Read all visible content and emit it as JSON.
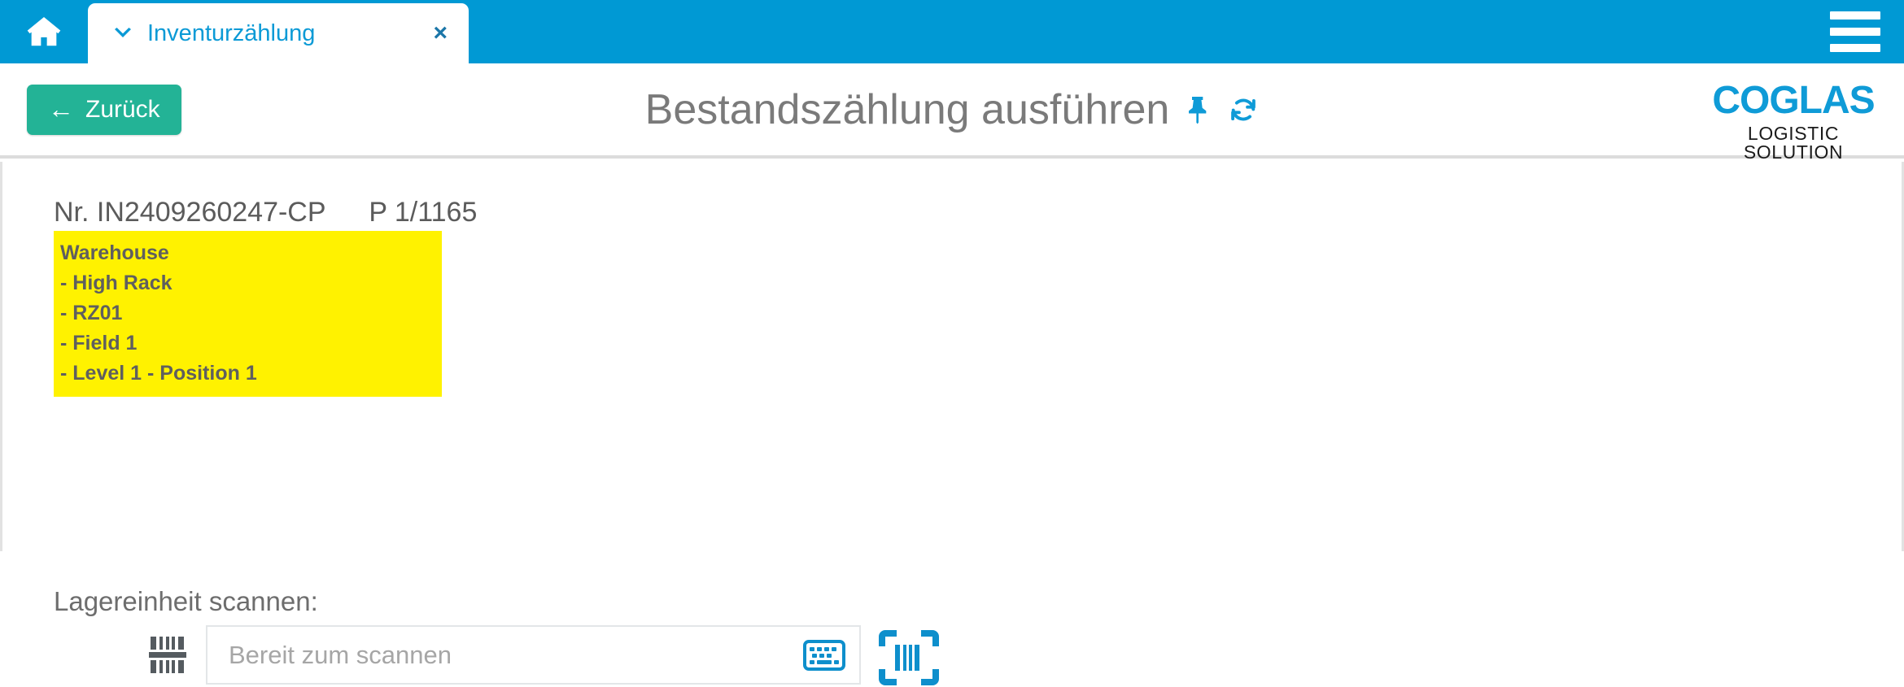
{
  "topbar": {
    "home_icon": "home-icon",
    "menu_icon": "hamburger-menu-icon",
    "tab": {
      "caret_icon": "chevron-down-icon",
      "label": "Inventurzählung",
      "close_label": "×"
    },
    "bg_color": "#0099d4"
  },
  "header": {
    "back_button": {
      "label": "Zurück",
      "arrow": "←",
      "color": "#23b396"
    },
    "title": "Bestandszählung ausführen",
    "pin_icon": "pin-icon",
    "refresh_icon": "refresh-icon",
    "icon_color": "#0f9bd7",
    "logo": {
      "main": "COGLAS",
      "sub": "LOGISTIC SOLUTION",
      "color": "#0f9bd7"
    }
  },
  "content": {
    "record_number": "Nr. IN2409260247-CP",
    "page_counter": "P 1/1165",
    "location_box": {
      "highlight_color": "#fff200",
      "lines": [
        "Warehouse",
        "- High Rack",
        "- RZ01",
        "- Field 1",
        "- Level 1 - Position 1"
      ]
    },
    "scan_label": "Lagereinheit scannen:",
    "scan_field": {
      "value": "",
      "placeholder": "Bereit zum scannen",
      "left_icon": "barcode-icon",
      "keyboard_icon": "keyboard-icon",
      "scan_icon": "barcode-scan-icon"
    }
  }
}
